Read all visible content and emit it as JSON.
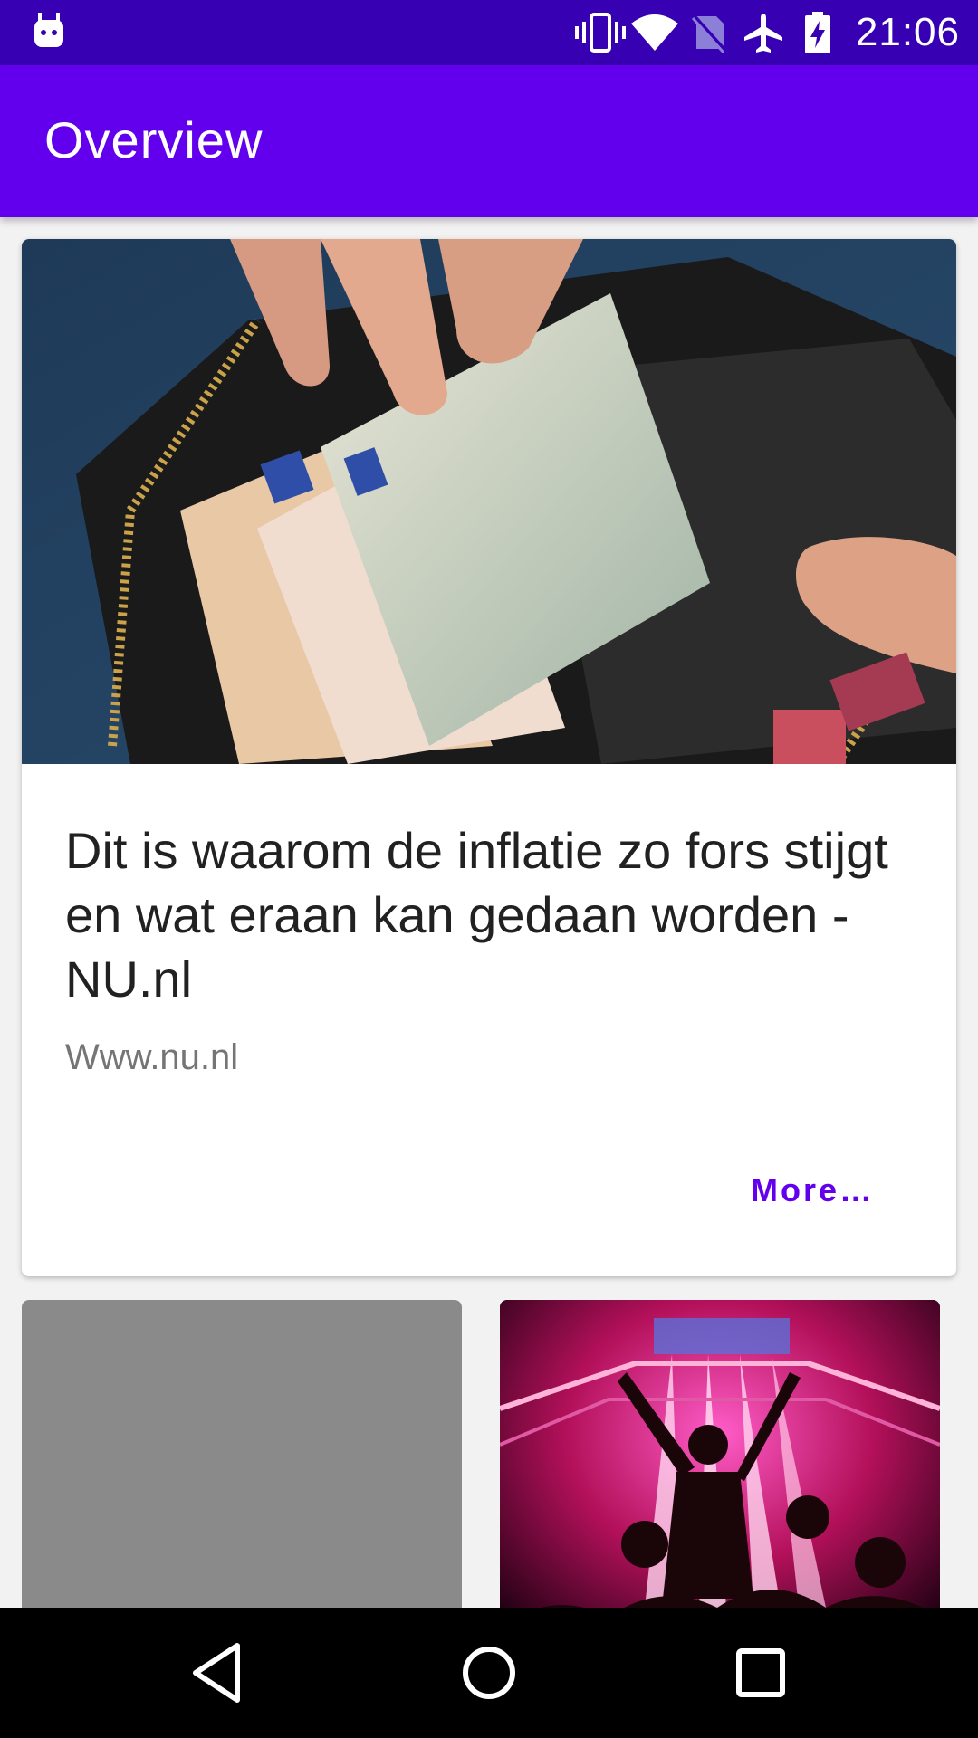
{
  "status_bar": {
    "time": "21:06",
    "icons": [
      "android-debug-icon",
      "vibrate-icon",
      "wifi-icon",
      "no-sim-icon",
      "airplane-mode-icon",
      "battery-charging-icon"
    ]
  },
  "app_bar": {
    "title": "Overview"
  },
  "feature_card": {
    "image": "wallet-with-euro-banknotes-photo",
    "headline": "Dit is waarom de inflatie zo fors stijgt en wat eraan kan gedaan worden - NU.nl",
    "source": "Www.nu.nl",
    "more_label": "More…"
  },
  "grid_cards": [
    {
      "image": "placeholder-gray"
    },
    {
      "image": "concert-crowd-pink-lights-photo"
    }
  ],
  "nav_bar": {
    "buttons": [
      "back-icon",
      "home-icon",
      "recents-icon"
    ]
  },
  "colors": {
    "status_bar": "#3700b3",
    "primary": "#6200ee",
    "accent_text": "#6200ee"
  }
}
